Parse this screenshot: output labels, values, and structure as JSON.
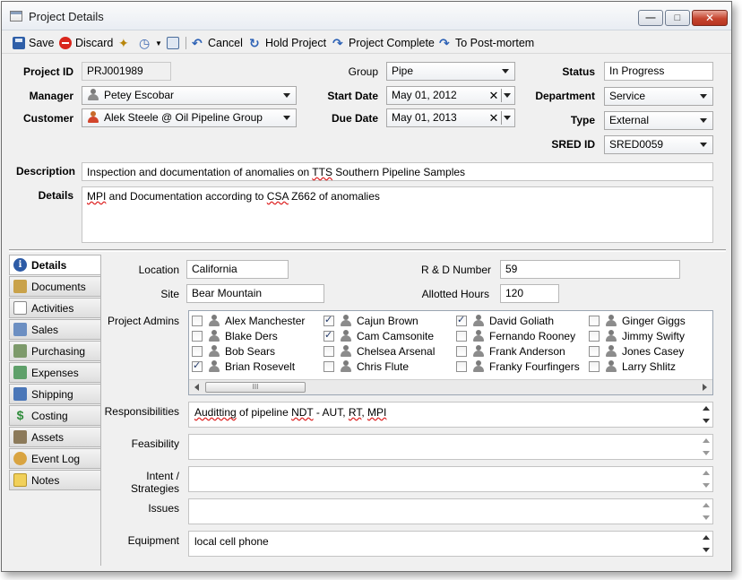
{
  "window": {
    "title": "Project Details"
  },
  "toolbar": {
    "save": "Save",
    "discard": "Discard",
    "cancel": "Cancel",
    "hold": "Hold Project",
    "complete": "Project Complete",
    "postmortem": "To Post-mortem"
  },
  "header": {
    "project_id_label": "Project ID",
    "project_id": "PRJ001989",
    "manager_label": "Manager",
    "manager": "Petey Escobar",
    "customer_label": "Customer",
    "customer": "Alek Steele @ Oil Pipeline Group",
    "group_label": "Group",
    "group": "Pipe",
    "start_label": "Start Date",
    "start": "May 01, 2012",
    "due_label": "Due Date",
    "due": "May 01, 2013",
    "status_label": "Status",
    "status": "In Progress",
    "department_label": "Department",
    "department": "Service",
    "type_label": "Type",
    "type": "External",
    "sred_label": "SRED ID",
    "sred": "SRED0059",
    "description_label": "Description",
    "description_pre": "Inspection and documentation of anomalies on ",
    "description_sq": "TTS",
    "description_post": " Southern Pipeline Samples",
    "details_label": "Details",
    "details_a": "MPI",
    "details_b": " and Documentation according to ",
    "details_c": "CSA",
    "details_d": " Z662 of anomalies"
  },
  "tabs": [
    {
      "label": "Details"
    },
    {
      "label": "Documents"
    },
    {
      "label": "Activities"
    },
    {
      "label": "Sales"
    },
    {
      "label": "Purchasing"
    },
    {
      "label": "Expenses"
    },
    {
      "label": "Shipping"
    },
    {
      "label": "Costing"
    },
    {
      "label": "Assets"
    },
    {
      "label": "Event Log"
    },
    {
      "label": "Notes"
    }
  ],
  "details": {
    "location_label": "Location",
    "location": "California",
    "site_label": "Site",
    "site": "Bear Mountain",
    "rd_label": "R & D Number",
    "rd": "59",
    "hours_label": "Allotted Hours",
    "hours": "120",
    "admins_label": "Project Admins",
    "admins": [
      {
        "name": "Alex Manchester",
        "checked": false
      },
      {
        "name": "Blake Ders",
        "checked": false
      },
      {
        "name": "Bob Sears",
        "checked": false
      },
      {
        "name": "Brian Rosevelt",
        "checked": true
      },
      {
        "name": "Cajun Brown",
        "checked": true
      },
      {
        "name": "Cam Camsonite",
        "checked": true
      },
      {
        "name": "Chelsea Arsenal",
        "checked": false
      },
      {
        "name": "Chris Flute",
        "checked": false
      },
      {
        "name": "David Goliath",
        "checked": true
      },
      {
        "name": "Fernando Rooney",
        "checked": false
      },
      {
        "name": "Frank Anderson",
        "checked": false
      },
      {
        "name": "Franky Fourfingers",
        "checked": false
      },
      {
        "name": "Ginger Giggs",
        "checked": false
      },
      {
        "name": "Jimmy Swifty",
        "checked": false
      },
      {
        "name": "Jones Casey",
        "checked": false
      },
      {
        "name": "Larry Shlitz",
        "checked": false
      }
    ],
    "scroll_thumb": "III",
    "responsibilities_label": "Responsibilities",
    "responsibilities_a": "Auditting",
    "responsibilities_b": " of pipeline ",
    "responsibilities_c": "NDT",
    "responsibilities_d": " - AUT, ",
    "responsibilities_e": "RT",
    "responsibilities_f": ", ",
    "responsibilities_g": "MPI",
    "feasibility_label": "Feasibility",
    "intent_label_1": "Intent /",
    "intent_label_2": "Strategies",
    "issues_label": "Issues",
    "equipment_label": "Equipment",
    "equipment": "local cell phone"
  }
}
